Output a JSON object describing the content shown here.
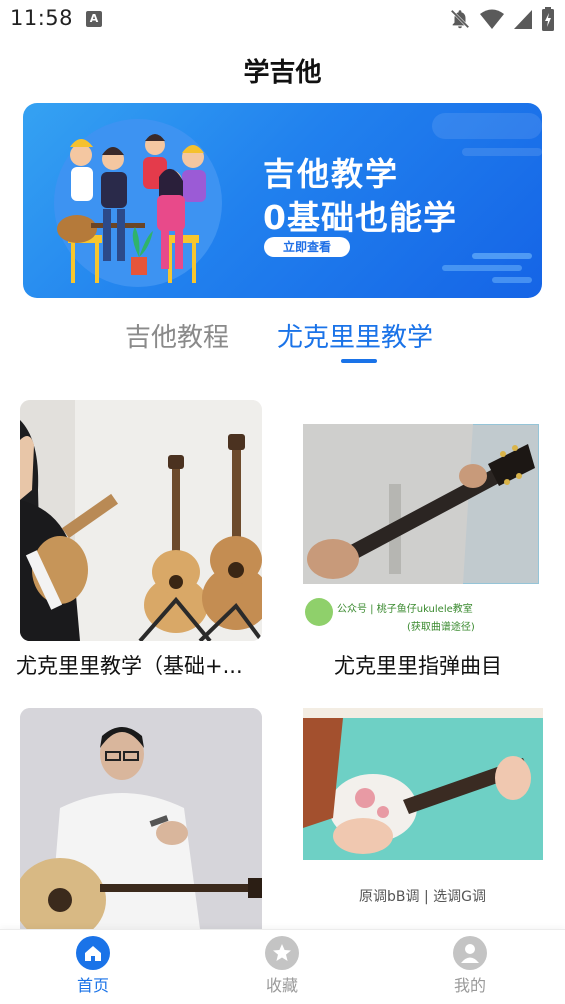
{
  "status_bar": {
    "time": "11:58",
    "badge_letter": "A",
    "icons": [
      "notifications-off-icon",
      "wifi-icon",
      "signal-icon",
      "battery-charging-icon"
    ]
  },
  "header": {
    "title": "学吉他"
  },
  "banner": {
    "line1": "吉他教学",
    "line2": "0基础也能学",
    "button_label": "立即查看"
  },
  "tabs": [
    {
      "label": "吉他教程",
      "active": false
    },
    {
      "label": "尤克里里教学",
      "active": true
    }
  ],
  "cards": [
    {
      "title": "尤克里里教学（基础+...",
      "overlay_text": ""
    },
    {
      "title": "尤克里里指弹曲目",
      "overlay_text": "公众号 | 桃子鱼仔ukulele教室",
      "overlay_sub": "(获取曲谱途径)"
    },
    {
      "title": "",
      "overlay_text": ""
    },
    {
      "title": "",
      "overlay_text": "原调bB调 | 选调G调"
    }
  ],
  "bottom_nav": [
    {
      "label": "首页",
      "icon": "home-icon",
      "active": true
    },
    {
      "label": "收藏",
      "icon": "star-icon",
      "active": false
    },
    {
      "label": "我的",
      "icon": "profile-icon",
      "active": false
    }
  ],
  "colors": {
    "accent": "#1a73e8",
    "inactive": "#9a9a9a"
  }
}
